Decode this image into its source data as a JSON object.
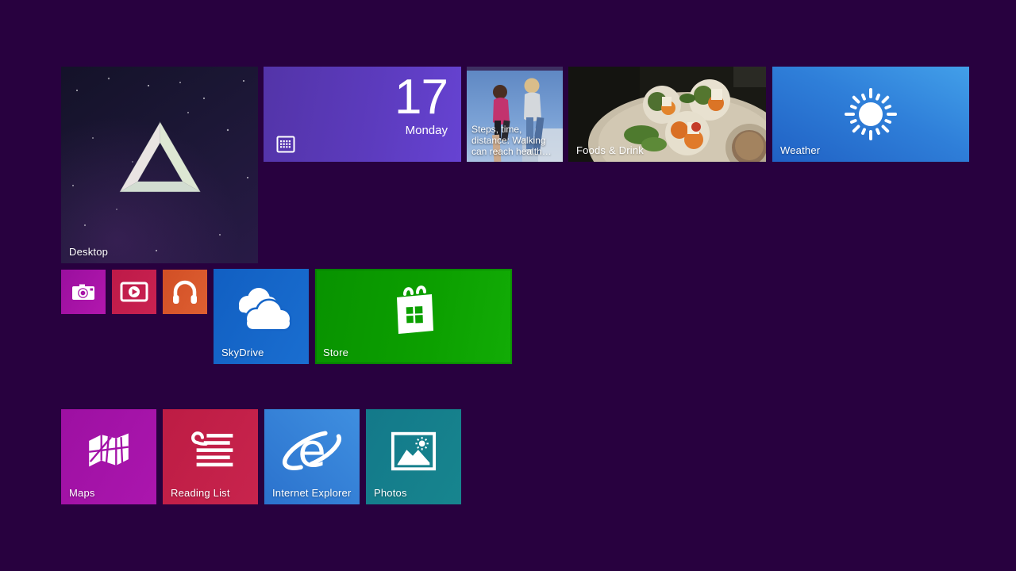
{
  "background_color": "#28013f",
  "tiles": {
    "desktop": {
      "label": "Desktop",
      "bg_color": "#1c1736"
    },
    "calendar": {
      "day": "17",
      "weekday": "Monday",
      "color": "#5c3bbd"
    },
    "health": {
      "lines": [
        "Steps, time,",
        "distance: Walking",
        "can reach health…"
      ]
    },
    "food": {
      "label": "Foods & Drink"
    },
    "weather": {
      "label": "Weather",
      "color": "#2f7fd9"
    },
    "camera": {
      "color": "#a412a4"
    },
    "video": {
      "color": "#c21d4d"
    },
    "music": {
      "color": "#d8562b"
    },
    "skydrive": {
      "label": "SkyDrive",
      "color": "#1464c8"
    },
    "store": {
      "label": "Store",
      "color": "#0a9600"
    },
    "maps": {
      "label": "Maps",
      "color": "#a312a8"
    },
    "reading_list": {
      "label": "Reading List",
      "color": "#c22048"
    },
    "internet_explorer": {
      "label": "Internet Explorer",
      "color": "#2e7ad6"
    },
    "photos": {
      "label": "Photos",
      "color": "#15818c"
    }
  }
}
